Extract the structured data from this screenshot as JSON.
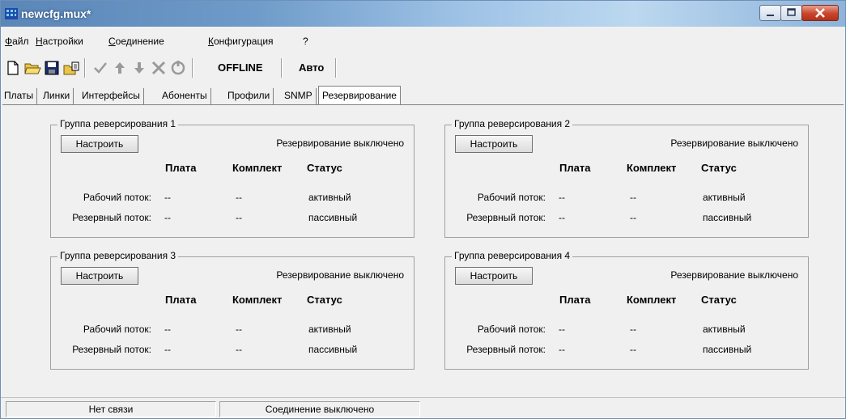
{
  "window": {
    "title": "newcfg.mux*"
  },
  "menu": {
    "items": [
      {
        "label": "Файл",
        "ul": "Ф",
        "rest": "айл"
      },
      {
        "label": "Настройки",
        "ul": "Н",
        "rest": "астройки"
      },
      {
        "label": "Соединение",
        "ul": "С",
        "rest": "оединение"
      },
      {
        "label": "Конфигурация",
        "ul": "К",
        "rest": "онфигурация"
      },
      {
        "label": "?",
        "ul": "",
        "rest": "?"
      }
    ]
  },
  "toolbar": {
    "icons": [
      "new-file-icon",
      "open-folder-icon",
      "save-icon",
      "export-icon",
      "checkmark-icon",
      "arrow-up-icon",
      "arrow-down-icon",
      "delete-x-icon",
      "reset-icon"
    ],
    "mode_label": "OFFLINE",
    "auto_label": "Авто"
  },
  "tabs": [
    {
      "label": "Платы"
    },
    {
      "label": "Линки"
    },
    {
      "label": "Интерфейсы"
    },
    {
      "label": "Абоненты"
    },
    {
      "label": "Профили"
    },
    {
      "label": "SNMP"
    },
    {
      "label": "Резервирование",
      "active": true
    }
  ],
  "groups": [
    {
      "title": "Группа реверсирования 1",
      "button": "Настроить",
      "status": "Резервирование выключено",
      "headers": {
        "board": "Плата",
        "kit": "Комплект",
        "state": "Статус"
      },
      "rows": [
        {
          "label": "Рабочий поток:",
          "board": "--",
          "kit": "--",
          "state": "активный"
        },
        {
          "label": "Резервный поток:",
          "board": "--",
          "kit": "--",
          "state": "пассивный"
        }
      ]
    },
    {
      "title": "Группа реверсирования 2",
      "button": "Настроить",
      "status": "Резервирование выключено",
      "headers": {
        "board": "Плата",
        "kit": "Комплект",
        "state": "Статус"
      },
      "rows": [
        {
          "label": "Рабочий поток:",
          "board": "--",
          "kit": "--",
          "state": "активный"
        },
        {
          "label": "Резервный поток:",
          "board": "--",
          "kit": "--",
          "state": "пассивный"
        }
      ]
    },
    {
      "title": "Группа реверсирования 3",
      "button": "Настроить",
      "status": "Резервирование выключено",
      "headers": {
        "board": "Плата",
        "kit": "Комплект",
        "state": "Статус"
      },
      "rows": [
        {
          "label": "Рабочий поток:",
          "board": "--",
          "kit": "--",
          "state": "активный"
        },
        {
          "label": "Резервный поток:",
          "board": "--",
          "kit": "--",
          "state": "пассивный"
        }
      ]
    },
    {
      "title": "Группа реверсирования 4",
      "button": "Настроить",
      "status": "Резервирование выключено",
      "headers": {
        "board": "Плата",
        "kit": "Комплект",
        "state": "Статус"
      },
      "rows": [
        {
          "label": "Рабочий поток:",
          "board": "--",
          "kit": "--",
          "state": "активный"
        },
        {
          "label": "Резервный поток:",
          "board": "--",
          "kit": "--",
          "state": "пассивный"
        }
      ]
    }
  ],
  "statusbar": {
    "connection": "Нет связи",
    "link_state": "Соединение выключено"
  },
  "colors": {
    "titlebar": "#6e9bc9",
    "close_button": "#c8442c",
    "window_bg": "#f0f0f0"
  }
}
